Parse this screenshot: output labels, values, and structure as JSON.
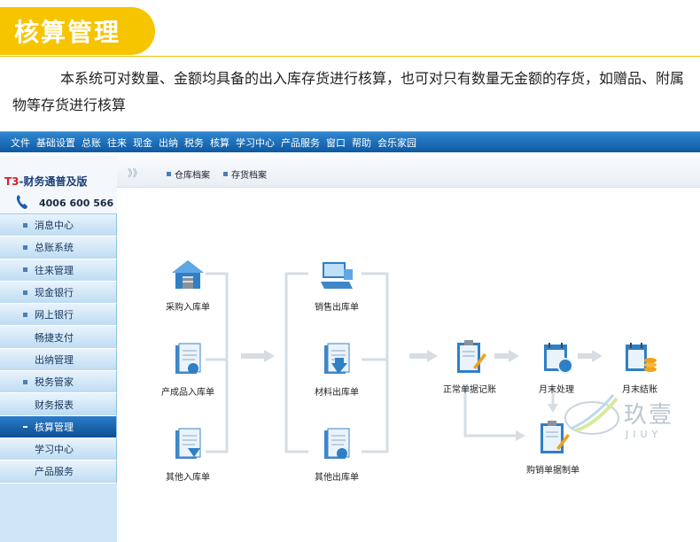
{
  "banner": {
    "title": "核算管理"
  },
  "intro": "本系统可对数量、金额均具备的出入库存货进行核算，也可对只有数量无金额的存货，如赠品、附属物等存货进行核算",
  "menubar": [
    "文件",
    "基础设置",
    "总账",
    "往来",
    "现金",
    "出纳",
    "税务",
    "核算",
    "学习中心",
    "产品服务",
    "窗口",
    "帮助",
    "会乐家园"
  ],
  "sidebar": {
    "logo": {
      "prefix": "T3",
      "text": "-财务通普及版"
    },
    "phone": "4006 600 566",
    "items": [
      {
        "label": "消息中心",
        "bullet": true,
        "active": false
      },
      {
        "label": "总账系统",
        "bullet": true,
        "active": false
      },
      {
        "label": "往来管理",
        "bullet": true,
        "active": false
      },
      {
        "label": "现金银行",
        "bullet": true,
        "active": false
      },
      {
        "label": "网上银行",
        "bullet": true,
        "active": false
      },
      {
        "label": "畅捷支付",
        "bullet": false,
        "active": false
      },
      {
        "label": "出纳管理",
        "bullet": false,
        "active": false
      },
      {
        "label": "税务管家",
        "bullet": true,
        "active": false
      },
      {
        "label": "财务报表",
        "bullet": false,
        "active": false
      },
      {
        "label": "核算管理",
        "bullet": true,
        "active": true
      },
      {
        "label": "学习中心",
        "bullet": false,
        "active": false
      },
      {
        "label": "产品服务",
        "bullet": false,
        "active": false
      }
    ]
  },
  "tabs": {
    "arrows": "》》",
    "tab1": "仓库档案",
    "tab2": "存货档案"
  },
  "flow": {
    "purchase_in": "采购入库单",
    "product_in": "产成品入库单",
    "other_in": "其他入库单",
    "sales_out": "销售出库单",
    "material_out": "材料出库单",
    "other_out": "其他出库单",
    "normal_post": "正常单据记账",
    "month_end": "月末处理",
    "month_close": "月末结账",
    "purchase_sales_voucher": "购销单据制单"
  },
  "watermark": {
    "text": "玖壹",
    "sub": "JIUY"
  },
  "colors": {
    "banner": "#f7c400",
    "menubar": "#0e5aa3",
    "sidebar": "#cfe6f6",
    "active": "#1467b3",
    "connector": "#d6dde3"
  }
}
